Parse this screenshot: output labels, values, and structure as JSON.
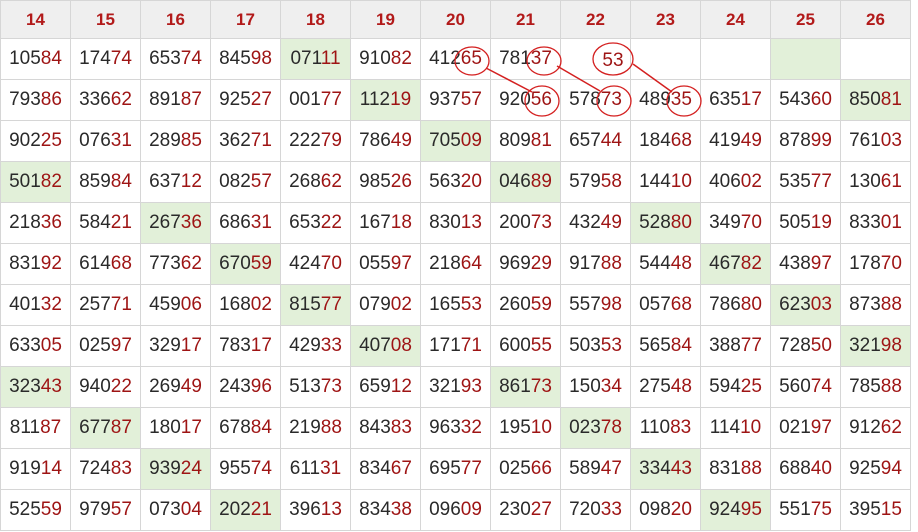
{
  "headers": [
    "14",
    "15",
    "16",
    "17",
    "18",
    "19",
    "20",
    "21",
    "22",
    "23",
    "24",
    "25",
    "26"
  ],
  "rows": [
    [
      "10584",
      "17474",
      "65374",
      "84598",
      "07111",
      "91082",
      "41265",
      "78137",
      "",
      "",
      "",
      "",
      ""
    ],
    [
      "79386",
      "33662",
      "89187",
      "92527",
      "00177",
      "11219",
      "93757",
      "92056",
      "57873",
      "48935",
      "63517",
      "54360",
      "85081"
    ],
    [
      "90225",
      "07631",
      "28985",
      "36271",
      "22279",
      "78649",
      "70509",
      "80981",
      "65744",
      "18468",
      "41949",
      "87899",
      "76103"
    ],
    [
      "50182",
      "85984",
      "63712",
      "08257",
      "26862",
      "98526",
      "56320",
      "04689",
      "57958",
      "14410",
      "40602",
      "53577",
      "13061"
    ],
    [
      "21836",
      "58421",
      "26736",
      "68631",
      "65322",
      "16718",
      "83013",
      "20073",
      "43249",
      "52880",
      "34970",
      "50519",
      "83301"
    ],
    [
      "83192",
      "61468",
      "77362",
      "67059",
      "42470",
      "05597",
      "21864",
      "96929",
      "91788",
      "54448",
      "46782",
      "43897",
      "17870"
    ],
    [
      "40132",
      "25771",
      "45906",
      "16802",
      "81577",
      "07902",
      "16553",
      "26059",
      "55798",
      "05768",
      "78680",
      "62303",
      "87388"
    ],
    [
      "63305",
      "02597",
      "32917",
      "78317",
      "42933",
      "40708",
      "17171",
      "60055",
      "50353",
      "56584",
      "38877",
      "72850",
      "32198"
    ],
    [
      "32343",
      "94022",
      "26949",
      "24396",
      "51373",
      "65912",
      "32193",
      "86173",
      "15034",
      "27548",
      "59425",
      "56074",
      "78588"
    ],
    [
      "81187",
      "67787",
      "18017",
      "67884",
      "21988",
      "84383",
      "96332",
      "19510",
      "02378",
      "11083",
      "11410",
      "02197",
      "91262"
    ],
    [
      "91914",
      "72483",
      "93924",
      "95574",
      "61131",
      "83467",
      "69577",
      "02566",
      "58947",
      "33443",
      "83188",
      "68840",
      "92594"
    ],
    [
      "52559",
      "97957",
      "07304",
      "20221",
      "39613",
      "83438",
      "09609",
      "23027",
      "72033",
      "09820",
      "92495",
      "55175",
      "39515"
    ]
  ],
  "highlighted": [
    [
      0,
      4
    ],
    [
      0,
      11
    ],
    [
      1,
      5
    ],
    [
      1,
      12
    ],
    [
      2,
      6
    ],
    [
      3,
      0
    ],
    [
      3,
      7
    ],
    [
      4,
      2
    ],
    [
      4,
      9
    ],
    [
      5,
      3
    ],
    [
      5,
      10
    ],
    [
      6,
      4
    ],
    [
      6,
      11
    ],
    [
      7,
      5
    ],
    [
      7,
      12
    ],
    [
      8,
      0
    ],
    [
      8,
      7
    ],
    [
      9,
      1
    ],
    [
      9,
      8
    ],
    [
      10,
      2
    ],
    [
      10,
      9
    ],
    [
      11,
      3
    ],
    [
      11,
      10
    ]
  ],
  "annotation": {
    "value": "53",
    "color": "#d42020"
  }
}
